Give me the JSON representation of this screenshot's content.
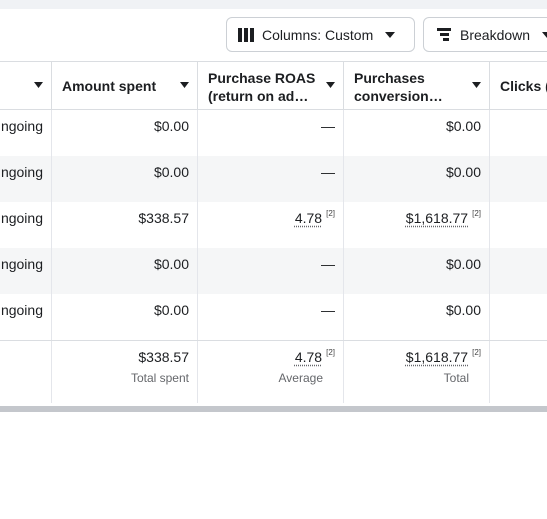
{
  "toolbar": {
    "columns_label": "Columns: Custom",
    "breakdown_label": "Breakdown"
  },
  "headers": {
    "amount_spent": "Amount spent",
    "purchase_roas": "Purchase ROAS (return on ad…",
    "purchases_conversion": "Purchases conversion…",
    "clicks": "Clicks ("
  },
  "rows": [
    {
      "delivery": "ngoing",
      "amount_spent": "$0.00",
      "roas": "—",
      "roas_fn": "",
      "conversion": "$0.00",
      "conversion_fn": ""
    },
    {
      "delivery": "ngoing",
      "amount_spent": "$0.00",
      "roas": "—",
      "roas_fn": "",
      "conversion": "$0.00",
      "conversion_fn": ""
    },
    {
      "delivery": "ngoing",
      "amount_spent": "$338.57",
      "roas": "4.78",
      "roas_fn": "[2]",
      "conversion": "$1,618.77",
      "conversion_fn": "[2]"
    },
    {
      "delivery": "ngoing",
      "amount_spent": "$0.00",
      "roas": "—",
      "roas_fn": "",
      "conversion": "$0.00",
      "conversion_fn": ""
    },
    {
      "delivery": "ngoing",
      "amount_spent": "$0.00",
      "roas": "—",
      "roas_fn": "",
      "conversion": "$0.00",
      "conversion_fn": ""
    }
  ],
  "summary": {
    "amount_spent": "$338.57",
    "amount_spent_sub": "Total spent",
    "roas": "4.78",
    "roas_fn": "[2]",
    "roas_sub": "Average",
    "conversion": "$1,618.77",
    "conversion_fn": "[2]",
    "conversion_sub": "Total"
  },
  "icons": {
    "columns": "columns-icon",
    "breakdown": "breakdown-icon",
    "caret": "caret-down-icon",
    "sort": "sort-caret-icon"
  },
  "colors": {
    "border": "#dadde1",
    "alt_row": "#f5f6f7",
    "muted_text": "#65676b"
  }
}
